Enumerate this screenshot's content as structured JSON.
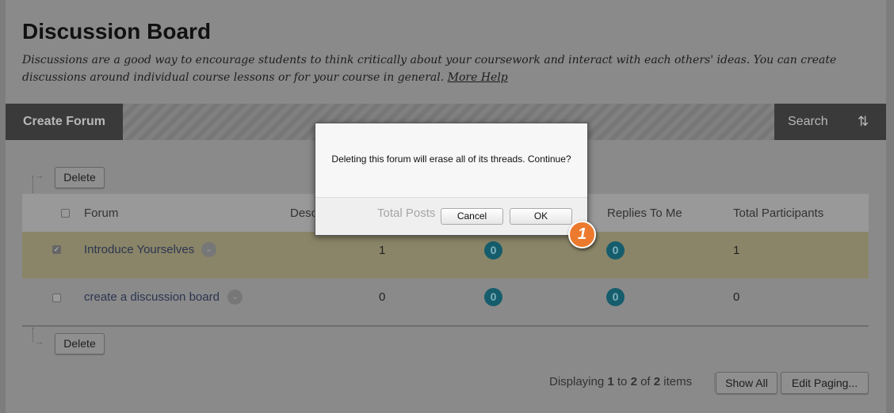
{
  "header": {
    "title": "Discussion Board",
    "intro": "Discussions are a good way to encourage students to think critically about your coursework and interact with each others' ideas. You can create discussions around individual course lessons or for your course in general.",
    "more_help": "More Help"
  },
  "toolbar": {
    "create_forum": "Create Forum",
    "search": "Search",
    "sort_icon": "sort-arrows-icon"
  },
  "actions": {
    "delete": "Delete"
  },
  "table": {
    "headers": {
      "forum": "Forum",
      "description": "Description",
      "total_posts": "Total Posts",
      "replies_to_me": "Replies To Me",
      "total_participants": "Total Participants"
    },
    "rows": [
      {
        "forum": "Introduce Yourselves",
        "checked": true,
        "total_posts": "1",
        "unread": "0",
        "replies_to_me": "0",
        "total_participants": "1"
      },
      {
        "forum": "create a discussion board",
        "checked": false,
        "total_posts": "0",
        "unread": "0",
        "replies_to_me": "0",
        "total_participants": "0"
      }
    ]
  },
  "paging": {
    "displaying": "Displaying",
    "from": "1",
    "to_label": "to",
    "to": "2",
    "of_label": "of",
    "total": "2",
    "items": "items",
    "show_all": "Show All",
    "edit_paging": "Edit Paging..."
  },
  "dialog": {
    "message": "Deleting this forum will erase all of its threads. Continue?",
    "cancel": "Cancel",
    "ok": "OK"
  },
  "step_marker": "1",
  "colors": {
    "highlight_row": "#8a8568",
    "badge": "#155d6c",
    "step_marker": "#ec7a2e"
  }
}
